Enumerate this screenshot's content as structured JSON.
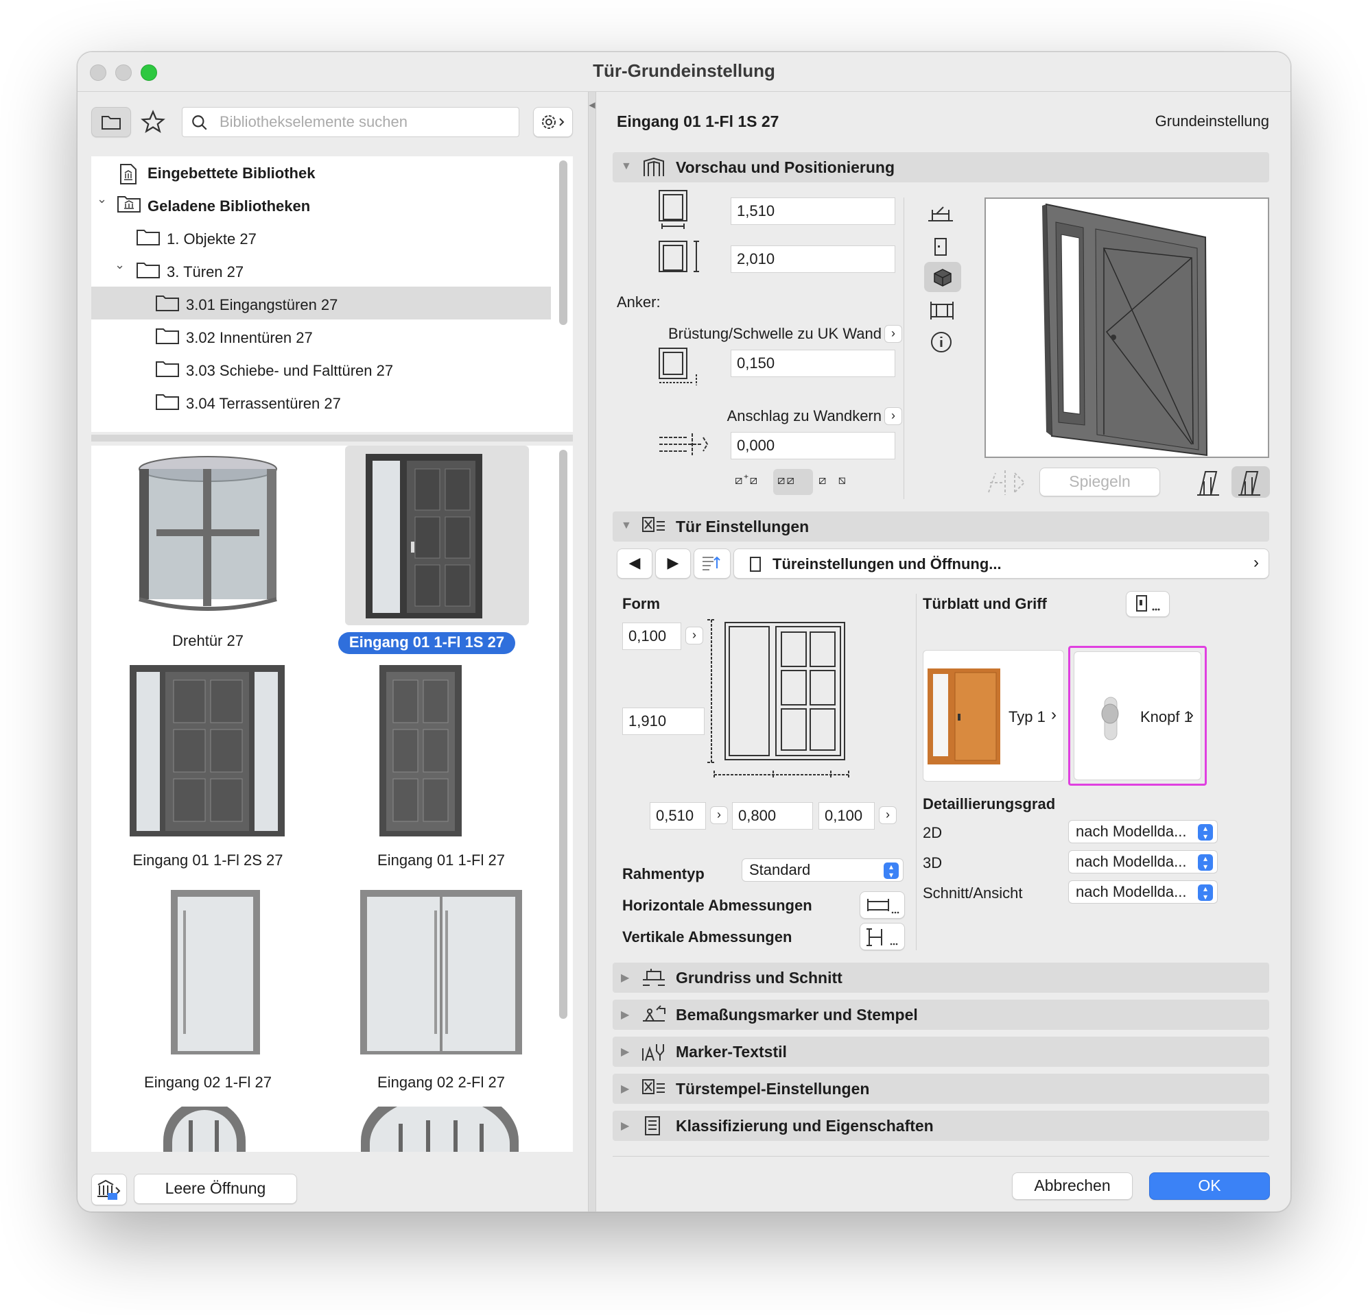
{
  "window": {
    "title": "Tür-Grundeinstellung"
  },
  "left": {
    "search_placeholder": "Bibliothekselemente suchen",
    "tree": [
      {
        "label": "Eingebettete Bibliothek"
      },
      {
        "label": "Geladene Bibliotheken"
      },
      {
        "label": "1. Objekte 27"
      },
      {
        "label": "3. Türen 27"
      },
      {
        "label": "3.01 Eingangstüren 27"
      },
      {
        "label": "3.02 Innentüren 27"
      },
      {
        "label": "3.03 Schiebe- und Falttüren 27"
      },
      {
        "label": "3.04 Terrassentüren 27"
      }
    ],
    "thumbs": [
      {
        "label": "Drehtür 27"
      },
      {
        "label": "Eingang 01 1-Fl 1S 27"
      },
      {
        "label": "Eingang 01 1-Fl 2S 27"
      },
      {
        "label": "Eingang 01 1-Fl 27"
      },
      {
        "label": "Eingang 02 1-Fl 27"
      },
      {
        "label": "Eingang 02 2-Fl 27"
      }
    ],
    "empty_opening_button": "Leere Öffnung"
  },
  "right": {
    "element_name": "Eingang 01 1-Fl 1S 27",
    "mode_label": "Grundeinstellung",
    "preview": {
      "section_title": "Vorschau und Positionierung",
      "width": "1,510",
      "height": "2,010",
      "anchor_label": "Anker:",
      "sill_label": "Brüstung/Schwelle zu UK Wand",
      "sill_value": "0,150",
      "reveal_label": "Anschlag zu Wandkern",
      "reveal_value": "0,000",
      "mirror_button": "Spiegeln"
    },
    "door_settings": {
      "section_title": "Tür Einstellungen",
      "page_selector": "Türeinstellungen und Öffnung...",
      "form_label": "Form",
      "form_top": "0,100",
      "form_height": "1,910",
      "form_bottom_1": "0,510",
      "form_bottom_2": "0,800",
      "form_bottom_3": "0,100",
      "leaf_label": "Türblatt und Griff",
      "type_label": "Typ 1",
      "knob_label": "Knopf 1",
      "detail_label": "Detaillierungsgrad",
      "detail_2d_label": "2D",
      "detail_3d_label": "3D",
      "detail_section_label": "Schnitt/Ansicht",
      "detail_2d_value": "nach Modellda...",
      "detail_3d_value": "nach Modellda...",
      "detail_section_value": "nach Modellda...",
      "frame_type_label": "Rahmentyp",
      "frame_type_value": "Standard",
      "horizontal_label": "Horizontale Abmessungen",
      "vertical_label": "Vertikale Abmessungen"
    },
    "collapsed_sections": [
      {
        "label": "Grundriss und Schnitt"
      },
      {
        "label": "Bemaßungsmarker und Stempel"
      },
      {
        "label": "Marker-Textstil"
      },
      {
        "label": "Türstempel-Einstellungen"
      },
      {
        "label": "Klassifizierung und Eigenschaften"
      }
    ],
    "cancel_button": "Abbrechen",
    "ok_button": "OK"
  },
  "colors": {
    "accent": "#3b82f6",
    "selection_label": "#2f6fdc",
    "highlight": "#e040e0",
    "traffic_red": "#d0d0d0",
    "traffic_green": "#2dc840"
  }
}
